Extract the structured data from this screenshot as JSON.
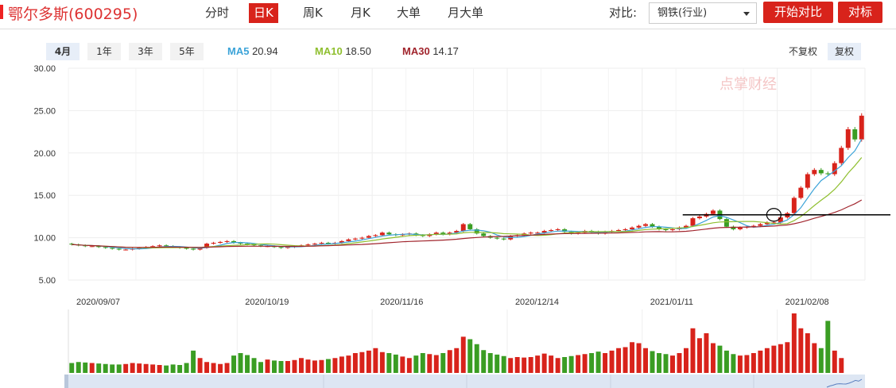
{
  "header": {
    "stock_title": "鄂尔多斯(600295)",
    "tabs": [
      {
        "label": "分时",
        "active": false
      },
      {
        "label": "日K",
        "active": true
      },
      {
        "label": "周K",
        "active": false
      },
      {
        "label": "月K",
        "active": false
      },
      {
        "label": "大单",
        "active": false
      },
      {
        "label": "月大单",
        "active": false
      }
    ],
    "compare_label": "对比:",
    "compare_select": "钢铁(行业)",
    "start_compare_label": "开始对比",
    "benchmark_label": "对标",
    "accent_color": "#d8231b"
  },
  "periods": [
    {
      "label": "4月",
      "active": true
    },
    {
      "label": "1年",
      "active": false
    },
    {
      "label": "3年",
      "active": false
    },
    {
      "label": "5年",
      "active": false
    }
  ],
  "ma_readout": [
    {
      "name": "MA5",
      "value": "20.94",
      "color": "#3ba3d8"
    },
    {
      "name": "MA10",
      "value": "18.50",
      "color": "#8fbf2f"
    },
    {
      "name": "MA30",
      "value": "14.17",
      "color": "#a1252d"
    }
  ],
  "adjust": [
    {
      "label": "不复权",
      "active": false
    },
    {
      "label": "复权",
      "active": true
    }
  ],
  "watermark": "点掌财经",
  "chart_data": {
    "type": "candlestick",
    "y_ticks": [
      "30.00",
      "25.00",
      "20.00",
      "15.00",
      "10.00",
      "5.00"
    ],
    "ylim": [
      5,
      30
    ],
    "x_tick_labels": [
      {
        "label": "2020/09/07",
        "index": 0
      },
      {
        "label": "2020/10/19",
        "index": 25
      },
      {
        "label": "2020/11/16",
        "index": 45
      },
      {
        "label": "2020/12/14",
        "index": 65
      },
      {
        "label": "2021/01/11",
        "index": 85
      },
      {
        "label": "2021/02/08",
        "index": 105
      }
    ],
    "up_color": "#d8231b",
    "down_color": "#3a9d23",
    "ma_colors": {
      "ma5": "#3ba3d8",
      "ma10": "#8fbf2f",
      "ma30": "#a1252d"
    },
    "reference_line_price": 12.7,
    "close": [
      9.2,
      9.1,
      9.0,
      9.0,
      8.9,
      8.8,
      8.7,
      8.6,
      8.6,
      8.7,
      8.8,
      8.9,
      9.0,
      9.1,
      9.0,
      8.9,
      8.8,
      8.7,
      8.6,
      8.8,
      9.3,
      9.4,
      9.5,
      9.6,
      9.4,
      9.3,
      9.2,
      9.1,
      9.0,
      9.0,
      8.9,
      8.8,
      8.9,
      9.0,
      9.1,
      9.2,
      9.3,
      9.4,
      9.3,
      9.4,
      9.6,
      9.8,
      9.9,
      10.0,
      10.2,
      10.3,
      10.6,
      10.4,
      10.3,
      10.4,
      10.5,
      10.3,
      10.2,
      10.4,
      10.6,
      10.4,
      10.6,
      10.8,
      11.6,
      11.0,
      10.5,
      10.2,
      10.0,
      9.9,
      9.8,
      10.2,
      10.3,
      10.5,
      10.6,
      10.6,
      10.8,
      10.9,
      11.0,
      10.7,
      10.5,
      10.6,
      10.8,
      10.7,
      10.5,
      10.7,
      10.8,
      10.9,
      11.0,
      11.2,
      11.4,
      11.6,
      11.3,
      11.0,
      10.9,
      11.0,
      11.2,
      11.4,
      12.3,
      12.5,
      12.8,
      13.2,
      12.2,
      11.3,
      11.0,
      11.2,
      11.3,
      11.4,
      11.6,
      11.8,
      11.8,
      12.4,
      12.9,
      14.7,
      15.9,
      17.5,
      18.0,
      17.6,
      17.5,
      18.8,
      20.6,
      22.8,
      21.6,
      24.4
    ],
    "volume": [
      0.2,
      0.22,
      0.21,
      0.2,
      0.19,
      0.18,
      0.17,
      0.17,
      0.18,
      0.2,
      0.19,
      0.18,
      0.17,
      0.16,
      0.15,
      0.17,
      0.16,
      0.2,
      0.45,
      0.3,
      0.22,
      0.2,
      0.18,
      0.2,
      0.35,
      0.4,
      0.36,
      0.3,
      0.22,
      0.27,
      0.25,
      0.24,
      0.24,
      0.26,
      0.3,
      0.27,
      0.25,
      0.26,
      0.28,
      0.3,
      0.33,
      0.35,
      0.4,
      0.42,
      0.45,
      0.5,
      0.42,
      0.4,
      0.37,
      0.33,
      0.3,
      0.35,
      0.4,
      0.38,
      0.36,
      0.4,
      0.46,
      0.5,
      0.73,
      0.68,
      0.58,
      0.46,
      0.4,
      0.37,
      0.34,
      0.3,
      0.32,
      0.31,
      0.32,
      0.35,
      0.39,
      0.35,
      0.3,
      0.32,
      0.34,
      0.36,
      0.38,
      0.4,
      0.43,
      0.4,
      0.45,
      0.5,
      0.52,
      0.62,
      0.6,
      0.5,
      0.44,
      0.4,
      0.38,
      0.35,
      0.4,
      0.5,
      0.9,
      0.7,
      0.8,
      0.6,
      0.55,
      0.45,
      0.38,
      0.35,
      0.36,
      0.4,
      0.45,
      0.5,
      0.55,
      0.58,
      0.62,
      1.2,
      0.9,
      0.8,
      0.6,
      0.5,
      1.05,
      0.45,
      0.3
    ]
  }
}
